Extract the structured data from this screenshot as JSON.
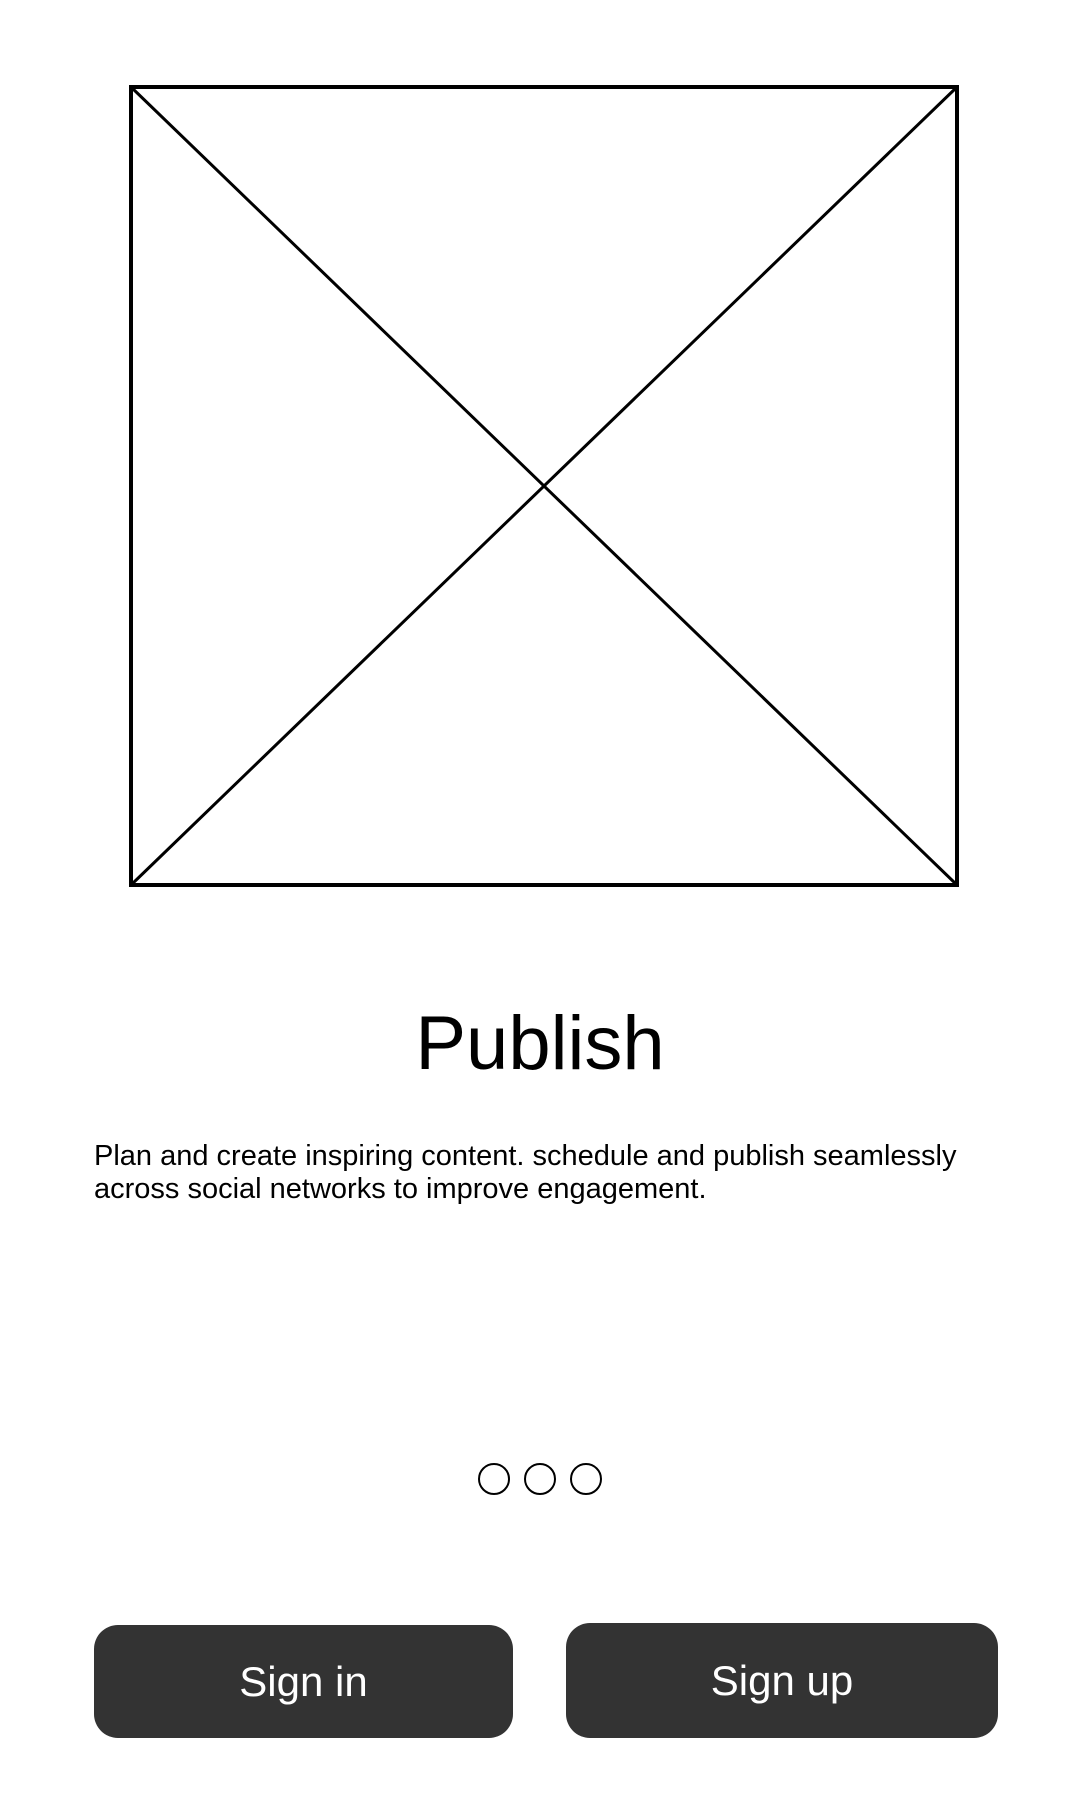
{
  "hero": {
    "icon": "image-placeholder-icon"
  },
  "title": "Publish",
  "description": "Plan and create inspiring content. schedule and publish seamlessly across social networks to improve engagement.",
  "pager": {
    "count": 3
  },
  "actions": {
    "sign_in_label": "Sign in",
    "sign_up_label": "Sign up"
  },
  "colors": {
    "button_background": "#333333",
    "button_text": "#ffffff",
    "text": "#000000",
    "background": "#ffffff"
  }
}
